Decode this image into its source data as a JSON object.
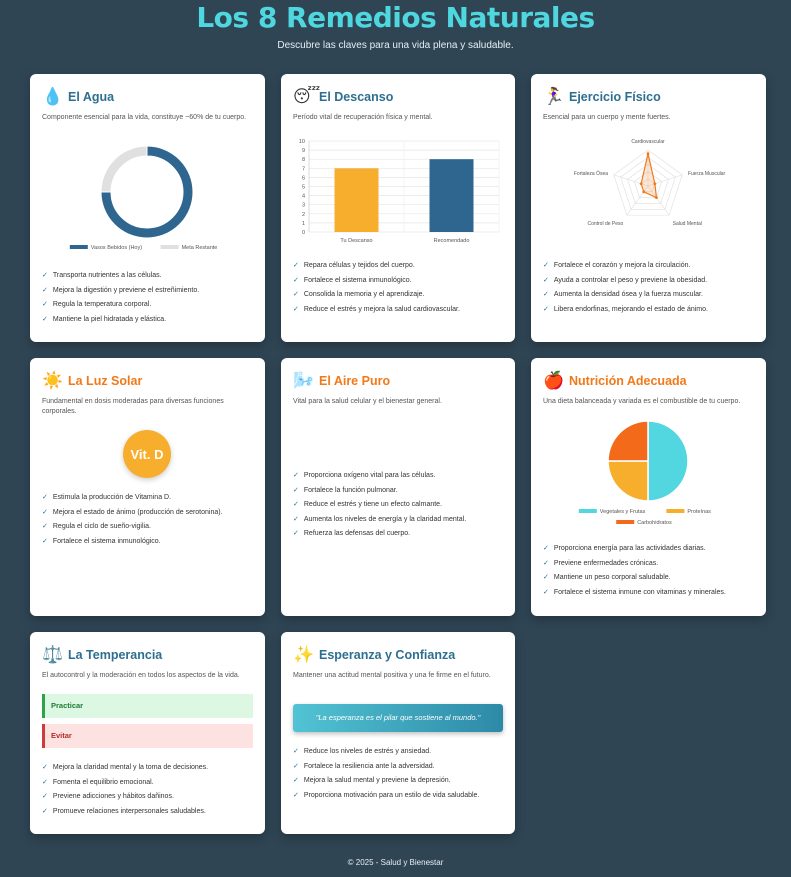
{
  "header": {
    "title": "Los 8 Remedios Naturales",
    "subtitle": "Descubre las claves para una vida plena y saludable."
  },
  "cards": {
    "agua": {
      "icon": "💧",
      "icon_name": "water-drop-icon",
      "title": "El Agua",
      "desc": "Componente esencial para la vida, constituye ~60% de tu cuerpo.",
      "items": [
        "Transporta nutrientes a las células.",
        "Mejora la digestión y previene el estreñimiento.",
        "Regula la temperatura corporal.",
        "Mantiene la piel hidratada y elástica."
      ]
    },
    "descanso": {
      "icon": "😴",
      "icon_name": "sleeping-face-icon",
      "title": "El Descanso",
      "desc": "Período vital de recuperación física y mental.",
      "items": [
        "Repara células y tejidos del cuerpo.",
        "Fortalece el sistema inmunológico.",
        "Consolida la memoria y el aprendizaje.",
        "Reduce el estrés y mejora la salud cardiovascular."
      ]
    },
    "ejercicio": {
      "icon": "🏃‍♀️",
      "icon_name": "running-woman-icon",
      "title": "Ejercicio Físico",
      "desc": "Esencial para un cuerpo y mente fuertes.",
      "items": [
        "Fortalece el corazón y mejora la circulación.",
        "Ayuda a controlar el peso y previene la obesidad.",
        "Aumenta la densidad ósea y la fuerza muscular.",
        "Libera endorfinas, mejorando el estado de ánimo."
      ]
    },
    "luz_solar": {
      "icon": "☀️",
      "icon_name": "sun-icon",
      "title": "La Luz Solar",
      "desc": "Fundamental en dosis moderadas para diversas funciones corporales.",
      "badge": "Vit. D",
      "items": [
        "Estimula la producción de Vitamina D.",
        "Mejora el estado de ánimo (producción de serotonina).",
        "Regula el ciclo de sueño-vigilia.",
        "Fortalece el sistema inmunológico."
      ]
    },
    "aire_puro": {
      "icon": "🌬️",
      "icon_name": "wind-face-icon",
      "title": "El Aire Puro",
      "desc": "Vital para la salud celular y el bienestar general.",
      "items": [
        "Proporciona oxígeno vital para las células.",
        "Fortalece la función pulmonar.",
        "Reduce el estrés y tiene un efecto calmante.",
        "Aumenta los niveles de energía y la claridad mental.",
        "Refuerza las defensas del cuerpo."
      ]
    },
    "nutricion": {
      "icon": "🍎",
      "icon_name": "apple-icon",
      "title": "Nutrición Adecuada",
      "desc": "Una dieta balanceada y variada es el combustible de tu cuerpo.",
      "items": [
        "Proporciona energía para las actividades diarias.",
        "Previene enfermedades crónicas.",
        "Mantiene un peso corporal saludable.",
        "Fortalece el sistema inmune con vitaminas y minerales."
      ]
    },
    "temperancia": {
      "icon": "⚖️",
      "icon_name": "balance-scale-icon",
      "title": "La Temperancia",
      "desc": "El autocontrol y la moderación en todos los aspectos de la vida.",
      "practicar": "Practicar",
      "evitar": "Evitar",
      "items": [
        "Mejora la claridad mental y la toma de decisiones.",
        "Fomenta el equilibrio emocional.",
        "Previene adicciones y hábitos dañinos.",
        "Promueve relaciones interpersonales saludables."
      ]
    },
    "esperanza": {
      "icon": "✨",
      "icon_name": "sparkles-icon",
      "title": "Esperanza y Confianza",
      "desc": "Mantener una actitud mental positiva y una fe firme en el futuro.",
      "quote": "\"La esperanza es el pilar que sostiene al mundo.\"",
      "items": [
        "Reduce los niveles de estrés y ansiedad.",
        "Fortalece la resiliencia ante la adversidad.",
        "Mejora la salud mental y previene la depresión.",
        "Proporciona motivación para un estilo de vida saludable."
      ]
    }
  },
  "chart_data": [
    {
      "type": "pie",
      "chart": "water-doughnut",
      "categories": [
        "Vasos Bebidos (Hoy)",
        "Meta Restante"
      ],
      "values": [
        6,
        2
      ],
      "colors": [
        "#2f6690",
        "#e0e0e0"
      ],
      "legend": "bottom"
    },
    {
      "type": "bar",
      "chart": "rest-bar",
      "categories": [
        "Tu Descanso",
        "Recomendado"
      ],
      "values": [
        7,
        8
      ],
      "colors": [
        "#f7ae2d",
        "#2f6690"
      ],
      "ylim": [
        0,
        10
      ],
      "yticks": [
        0,
        1,
        2,
        3,
        4,
        5,
        6,
        7,
        8,
        9,
        10
      ],
      "grid": true
    },
    {
      "type": "radar",
      "chart": "exercise-radar",
      "categories": [
        "Salud Cardiovascular",
        "Fuerza Muscular",
        "Salud Mental",
        "Control de Peso",
        "Fortaleza Ósea"
      ],
      "values": [
        9,
        2,
        4,
        2,
        2
      ],
      "max": 10,
      "color": "#f07a1a"
    },
    {
      "type": "pie",
      "chart": "nutrition-pie",
      "categories": [
        "Vegetales y Frutas",
        "Proteínas",
        "Carbohidratos"
      ],
      "values": [
        50,
        25,
        25
      ],
      "colors": [
        "#52d6df",
        "#f7ae2d",
        "#f36a1a"
      ],
      "legend": "bottom"
    }
  ],
  "footer": "© 2025 - Salud y Bienestar",
  "colors": {
    "background": "#2f4554",
    "accent": "#4fd7e0",
    "blue": "#2f6690",
    "orange": "#f07a1a",
    "yellow": "#f7ae2d"
  }
}
